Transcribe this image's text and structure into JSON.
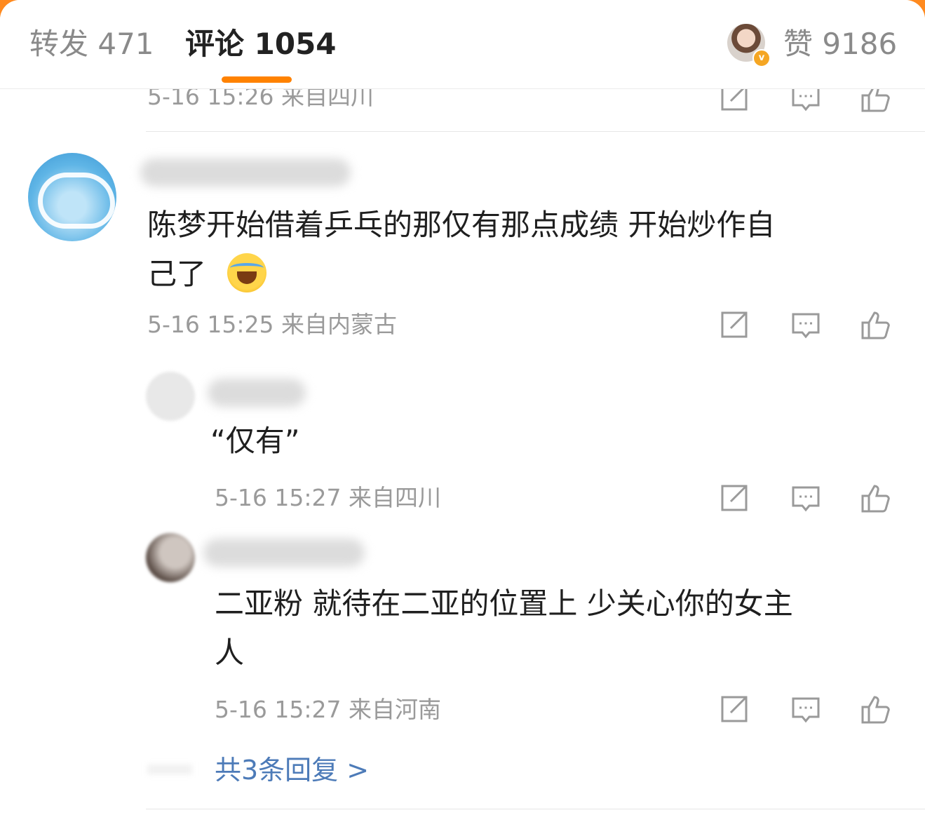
{
  "tabs": {
    "repost": "转发 471",
    "comment": "评论 1054",
    "like": "赞 9186",
    "author_badge": "v"
  },
  "top_meta": "5-16 15:26 来自四川",
  "comments": [
    {
      "name_visible": "枫叶",
      "text_line1": "陈梦开始借着乒乓的那仅有那点成绩  开始炒作自",
      "text_line2": "己了",
      "emoji": "laughing-crying-emoji",
      "meta": "5-16 15:25 来自内蒙古"
    }
  ],
  "replies": [
    {
      "text": "“仅有”",
      "meta": "5-16 15:27 来自四川"
    },
    {
      "text_line1": "二亚粉 就待在二亚的位置上  少关心你的女主",
      "text_line2": "人",
      "meta": "5-16 15:27 来自河南"
    }
  ],
  "more_replies": "共3条回复 >",
  "icons": {
    "repost": "repost-icon",
    "comment": "comment-icon",
    "like": "thumbs-up-icon"
  },
  "colors": {
    "accent": "#ff8200",
    "link": "#4d7bb8",
    "meta": "#9a9a9a"
  }
}
